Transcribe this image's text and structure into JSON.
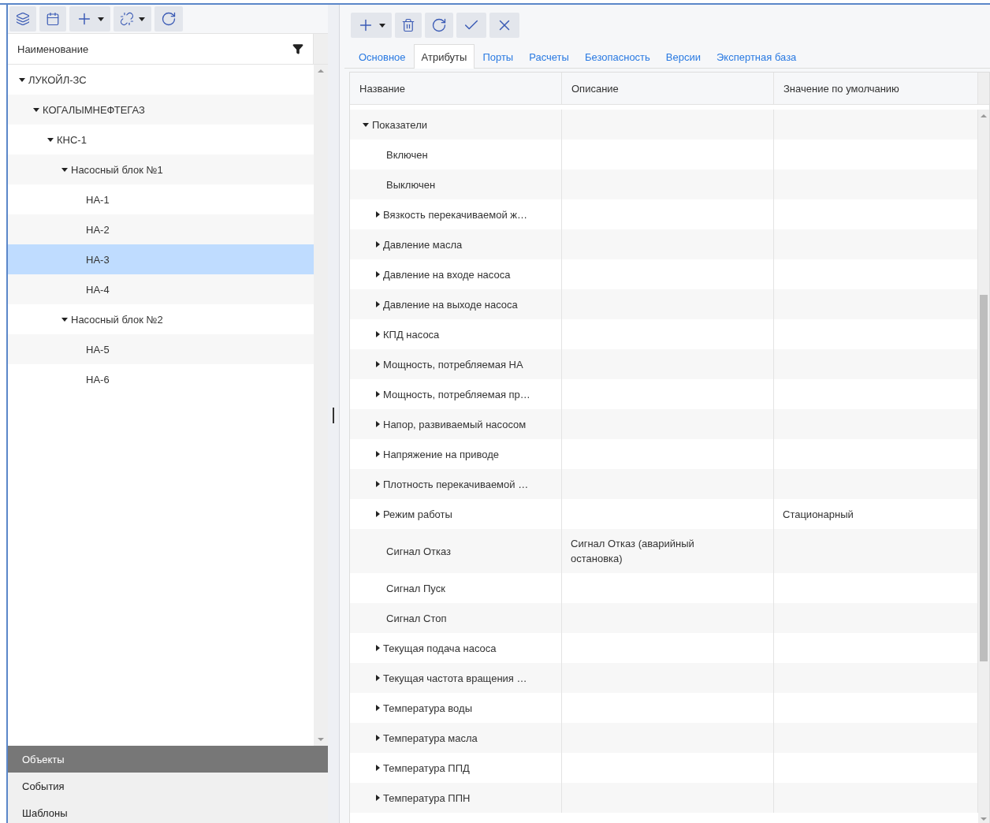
{
  "left_toolbar": {
    "buttons": [
      {
        "kind": "layers"
      },
      {
        "kind": "calendar"
      },
      {
        "kind": "add",
        "dropdown": true
      },
      {
        "kind": "unlink",
        "dropdown": true
      },
      {
        "kind": "refresh"
      }
    ]
  },
  "tree_header": {
    "label": "Наименование"
  },
  "tree": [
    {
      "label": "ЛУКОЙЛ-ЗС",
      "expanded": true,
      "selected": false,
      "children": [
        {
          "label": "КОГАЛЫМНЕФТЕГАЗ",
          "expanded": true,
          "selected": false,
          "children": [
            {
              "label": "КНС-1",
              "expanded": true,
              "selected": false,
              "children": [
                {
                  "label": "Насосный блок №1",
                  "expanded": true,
                  "selected": false,
                  "children": [
                    {
                      "label": "НА-1",
                      "selected": false
                    },
                    {
                      "label": "НА-2",
                      "selected": false
                    },
                    {
                      "label": "НА-3",
                      "selected": true
                    },
                    {
                      "label": "НА-4",
                      "selected": false
                    }
                  ]
                },
                {
                  "label": "Насосный блок №2",
                  "expanded": true,
                  "selected": false,
                  "children": [
                    {
                      "label": "НА-5",
                      "selected": false
                    },
                    {
                      "label": "НА-6",
                      "selected": false
                    }
                  ]
                }
              ]
            }
          ]
        }
      ]
    }
  ],
  "nav": [
    {
      "label": "Объекты",
      "selected": true
    },
    {
      "label": "События",
      "selected": false
    },
    {
      "label": "Шаблоны",
      "selected": false
    }
  ],
  "right_toolbar": {
    "buttons": [
      {
        "kind": "add",
        "dropdown": true
      },
      {
        "kind": "delete"
      },
      {
        "kind": "refresh"
      },
      {
        "kind": "apply"
      },
      {
        "kind": "cancel"
      }
    ]
  },
  "tabs": [
    {
      "label": "Основное",
      "selected": false
    },
    {
      "label": "Атрибуты",
      "selected": true
    },
    {
      "label": "Порты",
      "selected": false
    },
    {
      "label": "Расчеты",
      "selected": false
    },
    {
      "label": "Безопасность",
      "selected": false
    },
    {
      "label": "Версии",
      "selected": false
    },
    {
      "label": "Экспертная база",
      "selected": false
    }
  ],
  "table": {
    "columns": [
      "Название",
      "Описание",
      "Значение по умолчанию"
    ],
    "rows": [
      {
        "name": "Показатели",
        "kind": "group",
        "expanded": true,
        "children": [
          {
            "name": "Включен",
            "kind": "leaf"
          },
          {
            "name": "Выключен",
            "kind": "leaf"
          },
          {
            "name": "Вязкость перекачиваемой ж…",
            "kind": "group",
            "expanded": false
          },
          {
            "name": "Давление масла",
            "kind": "group",
            "expanded": false
          },
          {
            "name": "Давление на входе насоса",
            "kind": "group",
            "expanded": false
          },
          {
            "name": "Давление на выходе насоса",
            "kind": "group",
            "expanded": false
          },
          {
            "name": "КПД насоса",
            "kind": "group",
            "expanded": false
          },
          {
            "name": "Мощность, потребляемая НА",
            "kind": "group",
            "expanded": false
          },
          {
            "name": "Мощность, потребляемая пр…",
            "kind": "group",
            "expanded": false
          },
          {
            "name": "Напор, развиваемый насосом",
            "kind": "group",
            "expanded": false
          },
          {
            "name": "Напряжение на приводе",
            "kind": "group",
            "expanded": false
          },
          {
            "name": "Плотность перекачиваемой …",
            "kind": "group",
            "expanded": false
          },
          {
            "name": "Режим работы",
            "kind": "group",
            "expanded": false,
            "default": "Стационарный"
          },
          {
            "name": "Сигнал Отказ",
            "kind": "leaf",
            "description": "Сигнал Отказ (аварийный остановка)"
          },
          {
            "name": "Сигнал Пуск",
            "kind": "leaf"
          },
          {
            "name": "Сигнал Стоп",
            "kind": "leaf"
          },
          {
            "name": "Текущая подача насоса",
            "kind": "group",
            "expanded": false
          },
          {
            "name": "Текущая частота вращения …",
            "kind": "group",
            "expanded": false
          },
          {
            "name": "Температура воды",
            "kind": "group",
            "expanded": false
          },
          {
            "name": "Температура масла",
            "kind": "group",
            "expanded": false
          },
          {
            "name": "Температура ППД",
            "kind": "group",
            "expanded": false
          },
          {
            "name": "Температура ППН",
            "kind": "group",
            "expanded": false
          }
        ]
      }
    ]
  }
}
